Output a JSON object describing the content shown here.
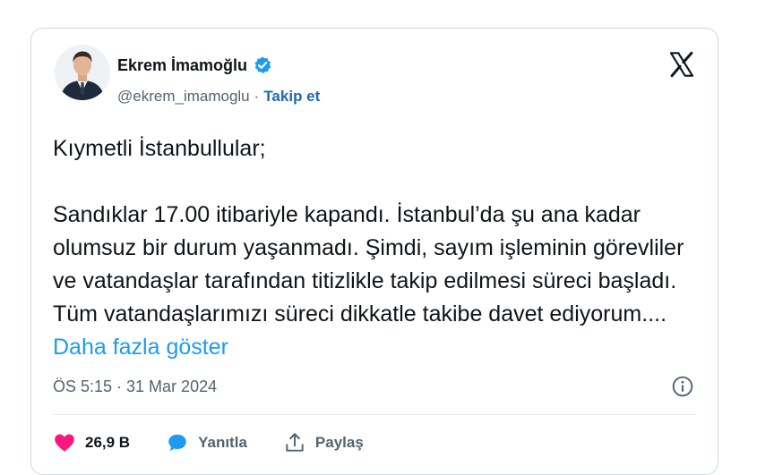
{
  "author": {
    "name": "Ekrem İmamoğlu",
    "handle": "@ekrem_imamoglu",
    "separator": "·",
    "follow_label": "Takip et"
  },
  "tweet": {
    "paragraph1": "Kıymetli İstanbullular;",
    "paragraph2": "Sandıklar 17.00 itibariyle kapandı. İstanbul’da şu ana kadar olumsuz bir durum yaşanmadı. Şimdi, sayım işleminin görevliler ve vatandaşlar tarafından titizlikle takip edilmesi süreci başladı. Tüm vatandaşlarımızı süreci dikkatle takibe davet ediyorum.... ",
    "show_more_label": "Daha fazla göster",
    "timestamp": "ÖS 5:15 · 31 Mar 2024"
  },
  "actions": {
    "like_count": "26,9 B",
    "reply_label": "Yanıtla",
    "share_label": "Paylaş"
  },
  "icons": {
    "logo": "x-logo-icon",
    "verified": "verified-badge-icon",
    "info": "info-icon",
    "like": "heart-icon",
    "reply": "speech-bubble-icon",
    "share": "share-icon"
  },
  "colors": {
    "link": "#1d9bf0",
    "follow": "#1d68b8",
    "like": "#f91880",
    "reply": "#1d9bf0",
    "muted": "#536471"
  }
}
